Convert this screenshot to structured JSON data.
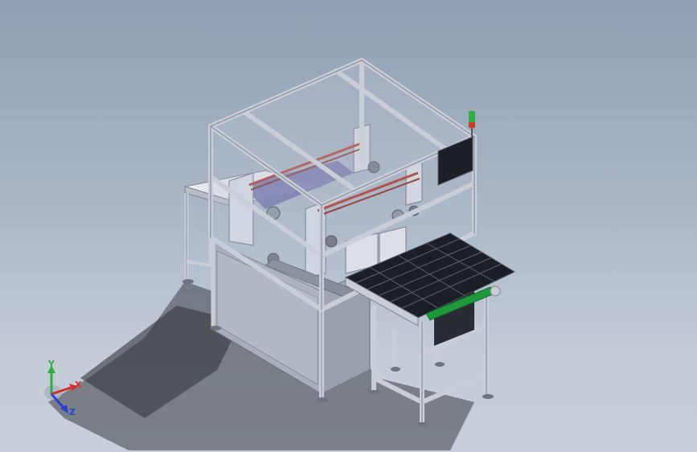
{
  "viewport": {
    "background_top": "#8f9fb3",
    "background_bottom": "#c7ced8"
  },
  "model": {
    "frame_color": "#c9ced6",
    "glass_color": "#b9c4d2",
    "cabinet_color": "#a9afba",
    "conveyor_belt_color": "#1e9a3c",
    "tray_color": "#1d1f26",
    "status_light_colors": [
      "#2fae45",
      "#2fae45",
      "#d23a2a"
    ]
  },
  "triad": {
    "x_label": "X",
    "y_label": "Y",
    "z_label": "Z",
    "x_color": "#d42b2b",
    "y_color": "#2fae45",
    "z_color": "#2b3fd4"
  }
}
